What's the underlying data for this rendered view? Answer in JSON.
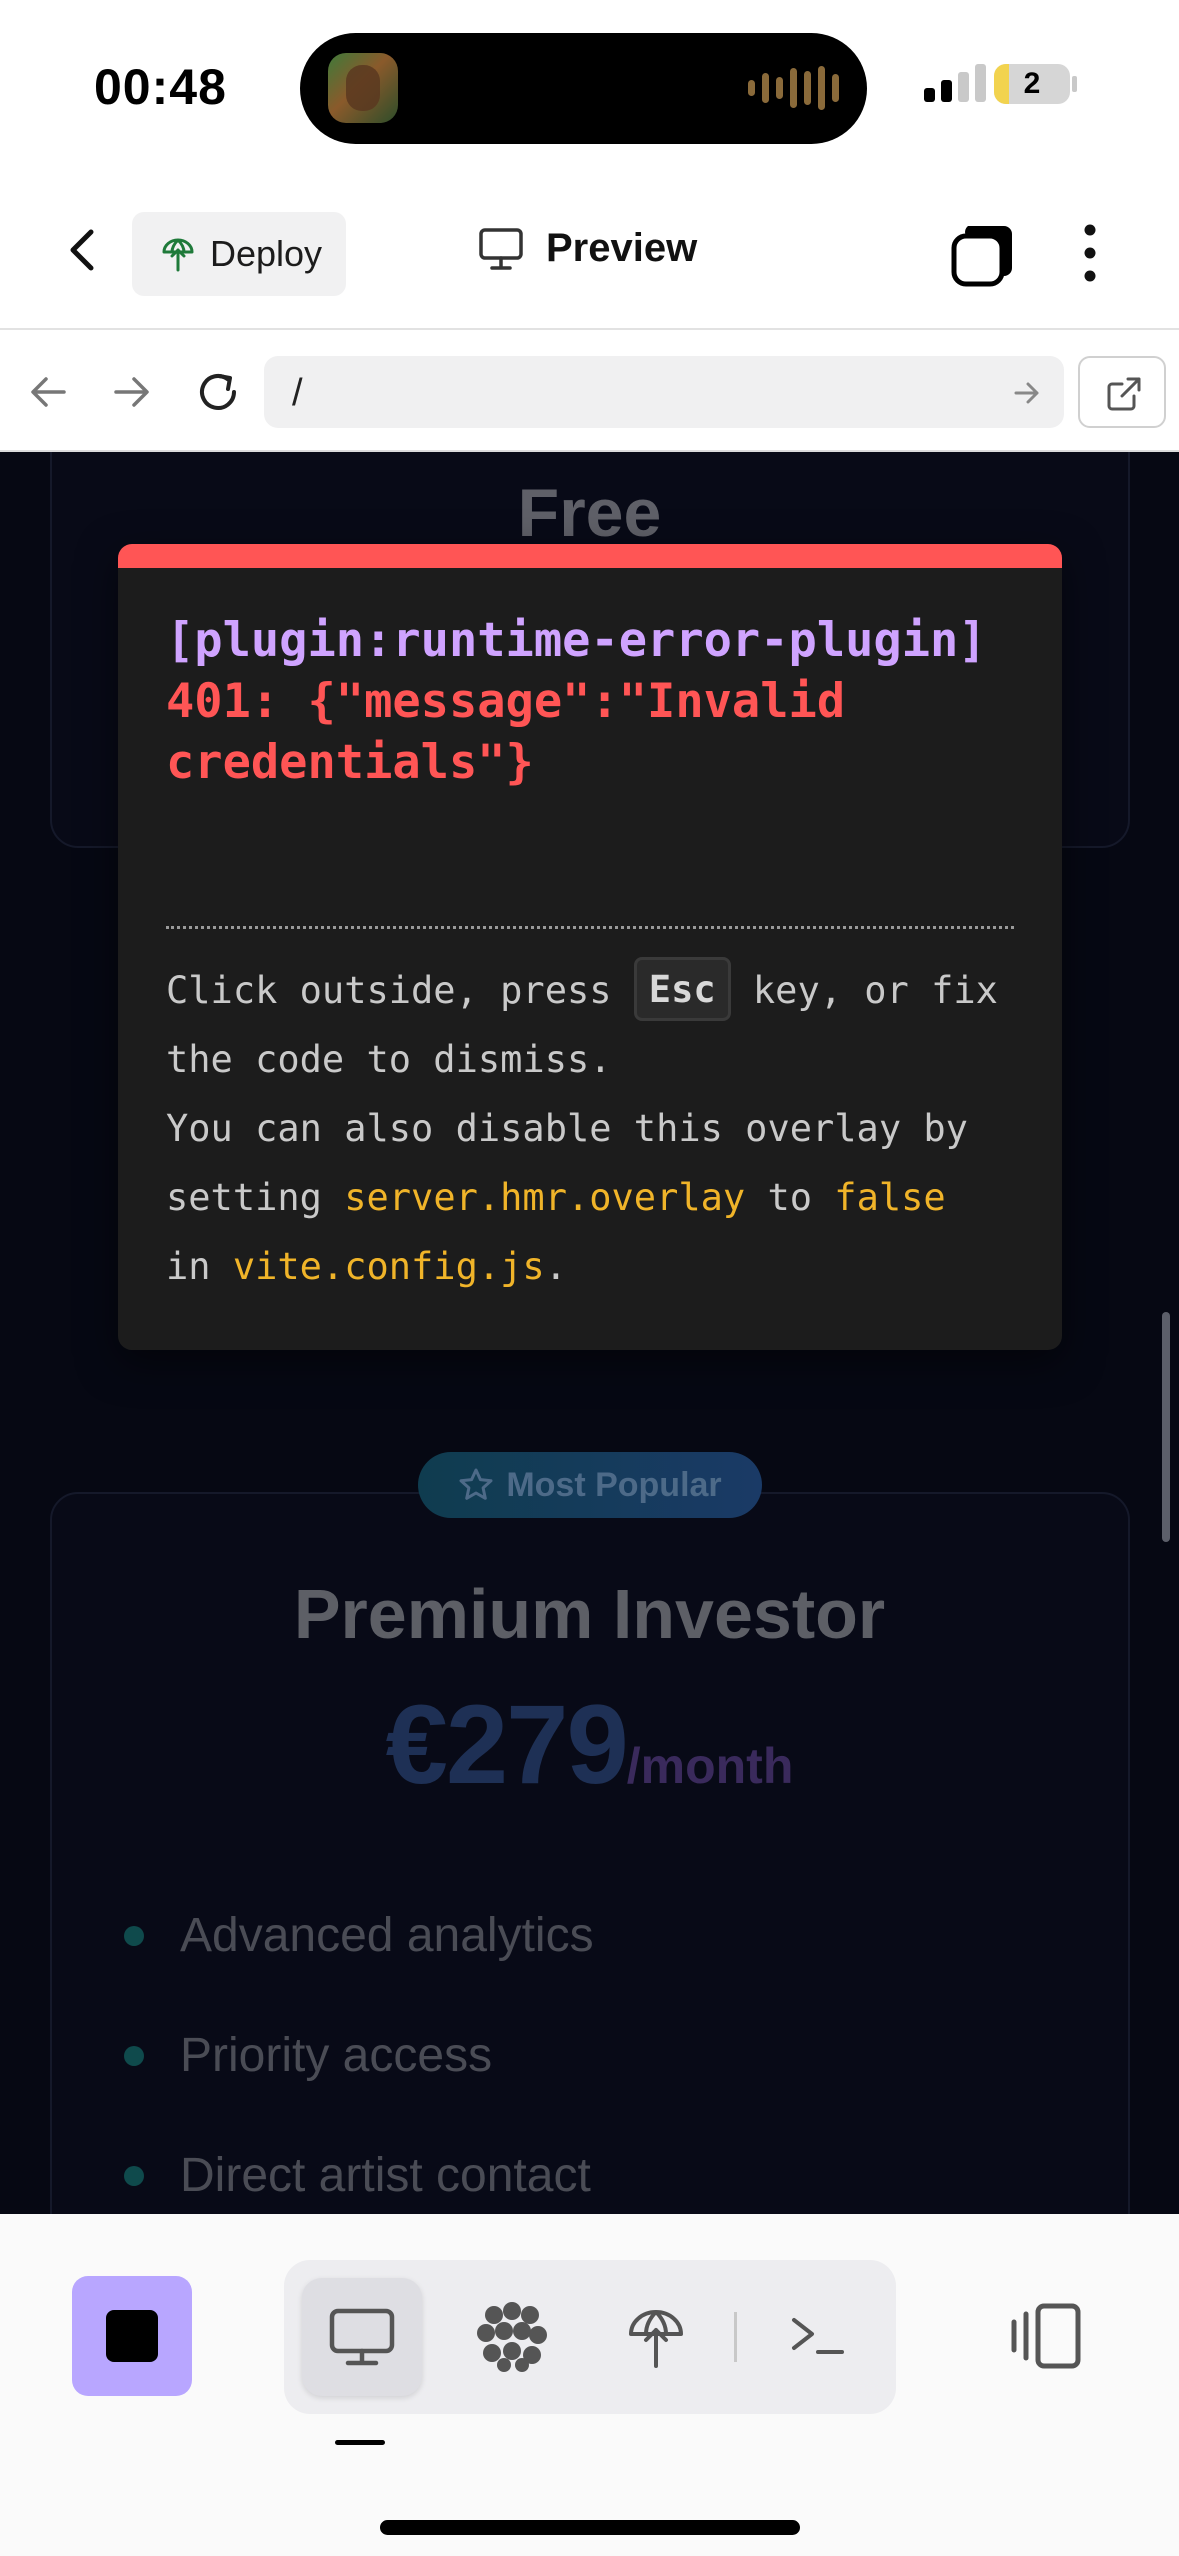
{
  "status": {
    "time": "00:48",
    "battery_level": "2",
    "battery_fraction": 0.2,
    "signal_bars_active": 2
  },
  "header": {
    "deploy_label": "Deploy",
    "preview_label": "Preview"
  },
  "browser": {
    "url": "/"
  },
  "page": {
    "free_card": {
      "title": "Free"
    },
    "premium_card": {
      "badge": "Most Popular",
      "title": "Premium Investor",
      "price": "€279",
      "period": "/month",
      "features": [
        "Advanced analytics",
        "Priority access",
        "Direct artist contact"
      ]
    }
  },
  "error_overlay": {
    "plugin": "[plugin:runtime-error-plugin]",
    "message": "401: {\"message\":\"Invalid credentials\"}",
    "tip": {
      "part1": "Click outside, press ",
      "key": "Esc",
      "part2": " key, or fix the code to dismiss.",
      "part3": "You can also disable this overlay by setting ",
      "code1": "server.hmr.overlay",
      "part4": " to ",
      "code2": "false",
      "part5": " in ",
      "code3": "vite.config.js",
      "part6": "."
    }
  },
  "toolbar": {
    "active_mode": "desktop-preview"
  },
  "colors": {
    "accent_stop": "#b8a6ff",
    "error_red": "#ff5555",
    "plugin_purple": "#cfa3ff",
    "code_yellow": "#f0b429",
    "preview_bg": "#060813"
  }
}
